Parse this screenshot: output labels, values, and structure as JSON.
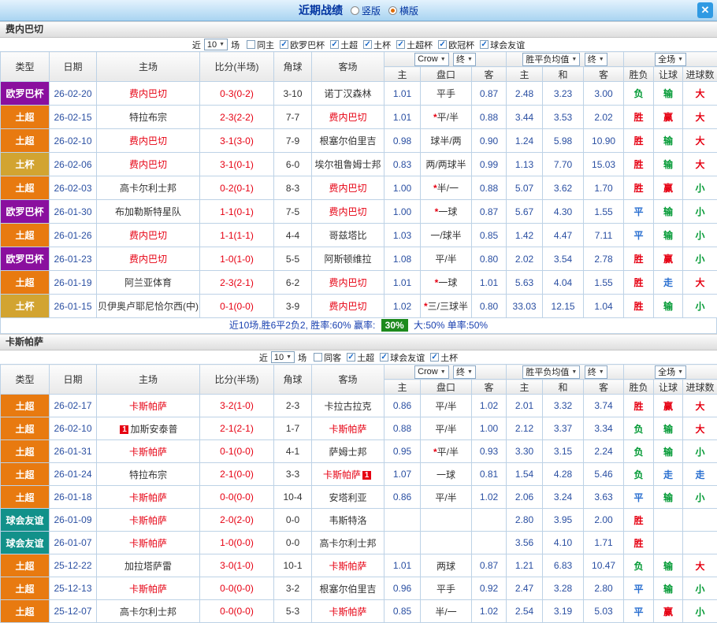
{
  "icons": {
    "dropdown_caret": "▼",
    "checkbox_check": "✓",
    "close": "✕"
  },
  "palette": {
    "date": "#2a4fa2",
    "odds": "#2a4fa2",
    "score": "#e60012",
    "focus_team": "#e60012",
    "team": "#333333",
    "corner": "#333333"
  },
  "type_colors": {
    "欧罗巴杯": "#8a0f9e",
    "土超": "#e87a10",
    "土杯": "#d2a431",
    "土超杯": "#bf7c16",
    "欧冠杯": "#1b3c8f",
    "球会友谊": "#12918a"
  },
  "result_colors": {
    "胜": "#e60012",
    "负": "#009933",
    "平": "#2a6fd0",
    "赢": "#e60012",
    "输": "#009933",
    "走": "#2a6fd0",
    "大": "#e60012",
    "小": "#009933"
  },
  "titlebar": {
    "title": "近期战绩",
    "radios": {
      "vertical": "竖版",
      "horizontal": "横版"
    }
  },
  "filter_labels": {
    "near": "近",
    "count": "10",
    "games": "场"
  },
  "columns": {
    "type": "类型",
    "date": "日期",
    "home": "主场",
    "score": "比分(半场)",
    "corner": "角球",
    "away": "客场",
    "odds_source": "Crow",
    "odds_final": "终",
    "avg_label": "胜平负均值",
    "avg_final": "终",
    "full": "全场",
    "sub_odds_home": "主",
    "sub_line": "盘口",
    "sub_odds_away": "客",
    "sub_avg_home": "主",
    "sub_avg_draw": "和",
    "sub_avg_away": "客",
    "sub_result": "胜负",
    "sub_let": "让球",
    "sub_goals": "进球数"
  },
  "sections": [
    {
      "team": "费内巴切",
      "filter_checkboxes": [
        {
          "label": "同主",
          "checked": false
        },
        {
          "label": "欧罗巴杯",
          "checked": true
        },
        {
          "label": "土超",
          "checked": true
        },
        {
          "label": "土杯",
          "checked": true
        },
        {
          "label": "土超杯",
          "checked": true
        },
        {
          "label": "欧冠杯",
          "checked": true
        },
        {
          "label": "球会友谊",
          "checked": true
        }
      ],
      "rows": [
        {
          "type": "欧罗巴杯",
          "date": "26-02-20",
          "home": "费内巴切",
          "home_red": true,
          "score": "0-3(0-2)",
          "corner": "3-10",
          "away": "诺丁汉森林",
          "o_home": "1.01",
          "o_line": "平手",
          "o_away": "0.87",
          "avg_home": "2.48",
          "avg_draw": "3.23",
          "avg_away": "3.00",
          "result": "负",
          "let": "输",
          "goal": "大"
        },
        {
          "type": "土超",
          "date": "26-02-15",
          "home": "特拉布宗",
          "score": "2-3(2-2)",
          "corner": "7-7",
          "away": "费内巴切",
          "away_red": true,
          "o_home": "1.01",
          "o_line": "*平/半",
          "o_away": "0.88",
          "avg_home": "3.44",
          "avg_draw": "3.53",
          "avg_away": "2.02",
          "result": "胜",
          "let": "赢",
          "goal": "大"
        },
        {
          "type": "土超",
          "date": "26-02-10",
          "home": "费内巴切",
          "home_red": true,
          "score": "3-1(3-0)",
          "corner": "7-9",
          "away": "根塞尔伯里吉",
          "o_home": "0.98",
          "o_line": "球半/两",
          "o_away": "0.90",
          "avg_home": "1.24",
          "avg_draw": "5.98",
          "avg_away": "10.90",
          "result": "胜",
          "let": "输",
          "goal": "大"
        },
        {
          "type": "土杯",
          "date": "26-02-06",
          "home": "费内巴切",
          "home_red": true,
          "score": "3-1(0-1)",
          "corner": "6-0",
          "away": "埃尔祖鲁姆士邦",
          "o_home": "0.83",
          "o_line": "两/两球半",
          "o_away": "0.99",
          "avg_home": "1.13",
          "avg_draw": "7.70",
          "avg_away": "15.03",
          "result": "胜",
          "let": "输",
          "goal": "大"
        },
        {
          "type": "土超",
          "date": "26-02-03",
          "home": "高卡尔利士邦",
          "score": "0-2(0-1)",
          "corner": "8-3",
          "away": "费内巴切",
          "away_red": true,
          "o_home": "1.00",
          "o_line": "*半/一",
          "o_away": "0.88",
          "avg_home": "5.07",
          "avg_draw": "3.62",
          "avg_away": "1.70",
          "result": "胜",
          "let": "赢",
          "goal": "小"
        },
        {
          "type": "欧罗巴杯",
          "date": "26-01-30",
          "home": "布加勒斯特星队",
          "score": "1-1(0-1)",
          "corner": "7-5",
          "away": "费内巴切",
          "away_red": true,
          "o_home": "1.00",
          "o_line": "*一球",
          "o_away": "0.87",
          "avg_home": "5.67",
          "avg_draw": "4.30",
          "avg_away": "1.55",
          "result": "平",
          "let": "输",
          "goal": "小"
        },
        {
          "type": "土超",
          "date": "26-01-26",
          "home": "费内巴切",
          "home_red": true,
          "score": "1-1(1-1)",
          "corner": "4-4",
          "away": "哥兹塔比",
          "o_home": "1.03",
          "o_line": "一/球半",
          "o_away": "0.85",
          "avg_home": "1.42",
          "avg_draw": "4.47",
          "avg_away": "7.11",
          "result": "平",
          "let": "输",
          "goal": "小"
        },
        {
          "type": "欧罗巴杯",
          "date": "26-01-23",
          "home": "费内巴切",
          "home_red": true,
          "score": "1-0(1-0)",
          "corner": "5-5",
          "away": "阿斯顿维拉",
          "o_home": "1.08",
          "o_line": "平/半",
          "o_away": "0.80",
          "avg_home": "2.02",
          "avg_draw": "3.54",
          "avg_away": "2.78",
          "result": "胜",
          "let": "赢",
          "goal": "小"
        },
        {
          "type": "土超",
          "date": "26-01-19",
          "home": "阿兰亚体育",
          "score": "2-3(2-1)",
          "corner": "6-2",
          "away": "费内巴切",
          "away_red": true,
          "o_home": "1.01",
          "o_line": "*一球",
          "o_away": "1.01",
          "avg_home": "5.63",
          "avg_draw": "4.04",
          "avg_away": "1.55",
          "result": "胜",
          "let": "走",
          "goal": "大"
        },
        {
          "type": "土杯",
          "date": "26-01-15",
          "home": "贝伊奥卢耶尼恰尔西(中)",
          "score": "0-1(0-0)",
          "corner": "3-9",
          "away": "费内巴切",
          "away_red": true,
          "o_home": "1.02",
          "o_line": "*三/三球半",
          "o_away": "0.80",
          "avg_home": "33.03",
          "avg_draw": "12.15",
          "avg_away": "1.04",
          "result": "胜",
          "let": "输",
          "goal": "小"
        }
      ],
      "summary": {
        "prefix": "近10场,胜6平2负2, 胜率:60% 赢率:",
        "badge": "30%",
        "suffix": "大:50% 单率:50%"
      }
    },
    {
      "team": "卡斯帕萨",
      "filter_checkboxes": [
        {
          "label": "同客",
          "checked": false
        },
        {
          "label": "土超",
          "checked": true
        },
        {
          "label": "球会友谊",
          "checked": true
        },
        {
          "label": "土杯",
          "checked": true
        }
      ],
      "rows": [
        {
          "type": "土超",
          "date": "26-02-17",
          "home": "卡斯帕萨",
          "home_red": true,
          "score": "3-2(1-0)",
          "corner": "2-3",
          "away": "卡拉古拉克",
          "o_home": "0.86",
          "o_line": "平/半",
          "o_away": "1.02",
          "avg_home": "2.01",
          "avg_draw": "3.32",
          "avg_away": "3.74",
          "result": "胜",
          "let": "赢",
          "goal": "大"
        },
        {
          "type": "土超",
          "date": "26-02-10",
          "home": "加斯安泰普",
          "home_badge": "1",
          "score": "2-1(2-1)",
          "corner": "1-7",
          "away": "卡斯帕萨",
          "away_red": true,
          "o_home": "0.88",
          "o_line": "平/半",
          "o_away": "1.00",
          "avg_home": "2.12",
          "avg_draw": "3.37",
          "avg_away": "3.34",
          "result": "负",
          "let": "输",
          "goal": "大"
        },
        {
          "type": "土超",
          "date": "26-01-31",
          "home": "卡斯帕萨",
          "home_red": true,
          "score": "0-1(0-0)",
          "corner": "4-1",
          "away": "萨姆士邦",
          "o_home": "0.95",
          "o_line": "*平/半",
          "o_away": "0.93",
          "avg_home": "3.30",
          "avg_draw": "3.15",
          "avg_away": "2.24",
          "result": "负",
          "let": "输",
          "goal": "小"
        },
        {
          "type": "土超",
          "date": "26-01-24",
          "home": "特拉布宗",
          "score": "2-1(0-0)",
          "corner": "3-3",
          "away": "卡斯帕萨",
          "away_red": true,
          "away_badge": "1",
          "o_home": "1.07",
          "o_line": "一球",
          "o_away": "0.81",
          "avg_home": "1.54",
          "avg_draw": "4.28",
          "avg_away": "5.46",
          "result": "负",
          "let": "走",
          "goal": "走"
        },
        {
          "type": "土超",
          "date": "26-01-18",
          "home": "卡斯帕萨",
          "home_red": true,
          "score": "0-0(0-0)",
          "corner": "10-4",
          "away": "安塔利亚",
          "o_home": "0.86",
          "o_line": "平/半",
          "o_away": "1.02",
          "avg_home": "2.06",
          "avg_draw": "3.24",
          "avg_away": "3.63",
          "result": "平",
          "let": "输",
          "goal": "小"
        },
        {
          "type": "球会友谊",
          "date": "26-01-09",
          "home": "卡斯帕萨",
          "home_red": true,
          "score": "2-0(2-0)",
          "corner": "0-0",
          "away": "韦斯特洛",
          "avg_home": "2.80",
          "avg_draw": "3.95",
          "avg_away": "2.00",
          "result": "胜"
        },
        {
          "type": "球会友谊",
          "date": "26-01-07",
          "home": "卡斯帕萨",
          "home_red": true,
          "score": "1-0(0-0)",
          "corner": "0-0",
          "away": "高卡尔利士邦",
          "avg_home": "3.56",
          "avg_draw": "4.10",
          "avg_away": "1.71",
          "result": "胜"
        },
        {
          "type": "土超",
          "date": "25-12-22",
          "home": "加拉塔萨雷",
          "score": "3-0(1-0)",
          "corner": "10-1",
          "away": "卡斯帕萨",
          "away_red": true,
          "o_home": "1.01",
          "o_line": "两球",
          "o_away": "0.87",
          "avg_home": "1.21",
          "avg_draw": "6.83",
          "avg_away": "10.47",
          "result": "负",
          "let": "输",
          "goal": "大"
        },
        {
          "type": "土超",
          "date": "25-12-13",
          "home": "卡斯帕萨",
          "home_red": true,
          "score": "0-0(0-0)",
          "corner": "3-2",
          "away": "根塞尔伯里吉",
          "o_home": "0.96",
          "o_line": "平手",
          "o_away": "0.92",
          "avg_home": "2.47",
          "avg_draw": "3.28",
          "avg_away": "2.80",
          "result": "平",
          "let": "输",
          "goal": "小"
        },
        {
          "type": "土超",
          "date": "25-12-07",
          "home": "高卡尔利士邦",
          "score": "0-0(0-0)",
          "corner": "5-3",
          "away": "卡斯帕萨",
          "away_red": true,
          "o_home": "0.85",
          "o_line": "半/一",
          "o_away": "1.02",
          "avg_home": "2.54",
          "avg_draw": "3.19",
          "avg_away": "5.03",
          "result": "平",
          "let": "赢",
          "goal": "小"
        }
      ]
    }
  ]
}
